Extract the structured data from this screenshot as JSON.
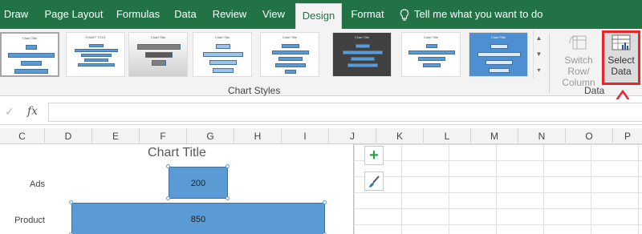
{
  "tabs": [
    {
      "label": "Draw"
    },
    {
      "label": "Page Layout"
    },
    {
      "label": "Formulas"
    },
    {
      "label": "Data"
    },
    {
      "label": "Review"
    },
    {
      "label": "View"
    },
    {
      "label": "Design"
    },
    {
      "label": "Format"
    }
  ],
  "active_tab": "Design",
  "tell_me": "Tell me what you want to do",
  "ribbon": {
    "chart_styles_label": "Chart Styles",
    "data_group_label": "Data",
    "switch_row_column": "Switch Row/ Column",
    "select_data": "Select Data",
    "thumbnails": [
      {
        "title": "Chart Title"
      },
      {
        "title": "CHART TITLE"
      },
      {
        "title": "Chart Title"
      },
      {
        "title": "Chart Title"
      },
      {
        "title": "Chart Title"
      },
      {
        "title": "Chart Title"
      },
      {
        "title": "Chart Title"
      },
      {
        "title": "Chart Title"
      }
    ]
  },
  "formula_bar": {
    "fx": "fx",
    "value": ""
  },
  "columns": [
    "C",
    "D",
    "E",
    "F",
    "G",
    "H",
    "I",
    "J",
    "K",
    "L",
    "M",
    "N",
    "O",
    "P"
  ],
  "colors": {
    "ribbon_green": "#217346",
    "bar_blue": "#5b9bd5",
    "highlight_red": "#e8262a"
  },
  "chart_data": {
    "type": "bar",
    "title": "Chart Title",
    "categories": [
      "Ads",
      "Product"
    ],
    "values": [
      200,
      850
    ],
    "data_labels": [
      "200",
      "850"
    ],
    "xlim": [
      -1000,
      1000
    ]
  }
}
